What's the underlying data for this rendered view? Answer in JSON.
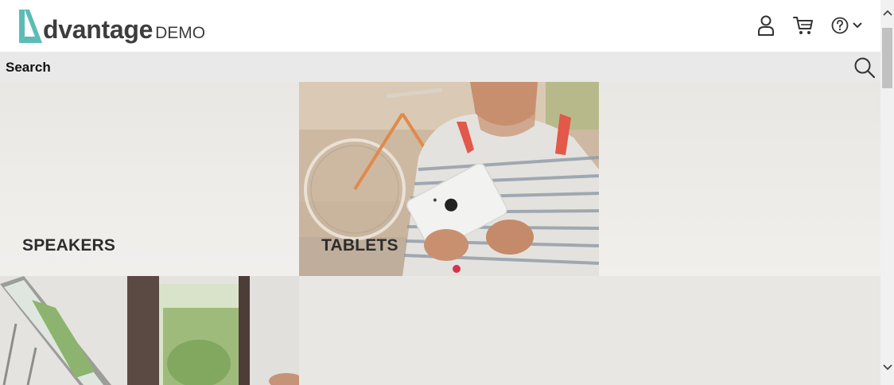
{
  "header": {
    "logo": {
      "word": "dvantage",
      "suffix": "DEMO",
      "mark_color": "#5bbcb7"
    },
    "icons": {
      "user": "user-icon",
      "cart": "cart-icon",
      "help": "help-icon",
      "help_menu": "chevron-down-icon"
    }
  },
  "search": {
    "label": "Search",
    "icon": "search-icon"
  },
  "categories": [
    {
      "label": "SPEAKERS"
    },
    {
      "label": "TABLETS"
    },
    {
      "label": ""
    },
    {
      "label": ""
    }
  ],
  "colors": {
    "header_bg": "#ffffff",
    "search_bg": "#e9e9e9",
    "text_dark": "#2d2d2d",
    "accent_teal": "#5bbcb7"
  },
  "scrollbar": {
    "up_icon": "chevron-up-icon",
    "down_icon": "chevron-down-icon"
  }
}
